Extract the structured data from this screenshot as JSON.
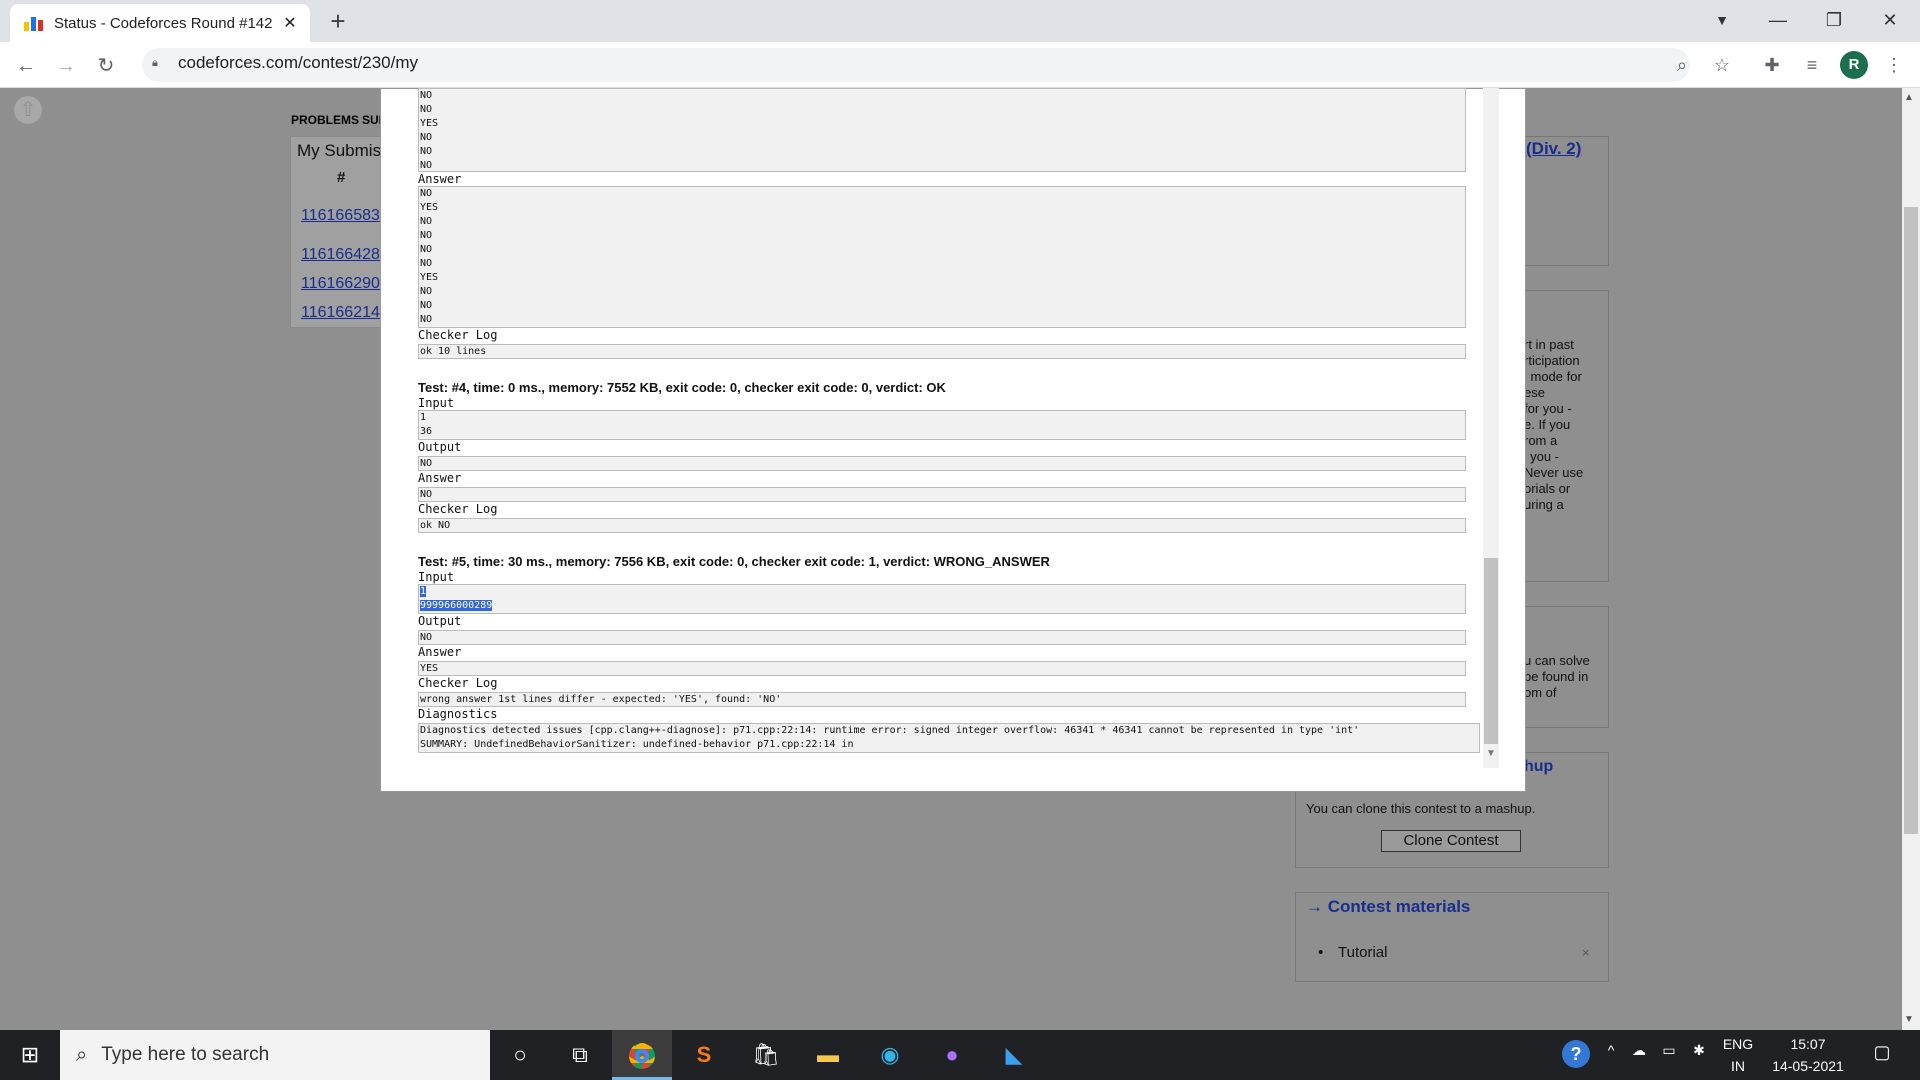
{
  "browser": {
    "tab_title": "Status - Codeforces Round #142",
    "tab_close": "✕",
    "new_tab": "+",
    "url": "codeforces.com/contest/230/my",
    "avatar_letter": "R",
    "controls": {
      "minimize": "—",
      "maximize": "❐",
      "close": "✕"
    }
  },
  "page": {
    "menu_problems": "PROBLEMS",
    "menu_submit": "SUB",
    "my_submissions_header": "My Submis",
    "table_header_hash": "#",
    "submissions": [
      "116166583",
      "116166428",
      "116166290",
      "116166214"
    ],
    "right_title": "(Div. 2)",
    "virtual_text": [
      "rt in past",
      "rticipation",
      "l mode for",
      "ese",
      "for you -",
      "e. If you",
      "rom a",
      "' you -",
      "Never use",
      "orials or",
      "uring a"
    ],
    "practice_text": [
      "u can solve",
      "be found in",
      "om of"
    ],
    "mashup_title": "hup",
    "mashup_text": "You can clone this contest to a mashup.",
    "clone_button": "Clone Contest",
    "materials_title": "→ Contest materials",
    "materials_item": "Tutorial",
    "materials_remove": "×"
  },
  "modal": {
    "test3_output_tail": [
      "NO",
      "NO",
      "YES",
      "NO",
      "NO",
      "NO"
    ],
    "answer_label": "Answer",
    "test3_answer": [
      "NO",
      "YES",
      "NO",
      "NO",
      "NO",
      "NO",
      "YES",
      "NO",
      "NO",
      "NO"
    ],
    "checker_log_label": "Checker Log",
    "test3_checker": "ok 10 lines",
    "test4_title": "Test: #4, time: 0 ms., memory: 7552 KB, exit code: 0, checker exit code: 0, verdict: OK",
    "input_label": "Input",
    "test4_input": [
      "1",
      "36"
    ],
    "output_label": "Output",
    "test4_output": "NO",
    "test4_answer": "NO",
    "test4_checker": "ok NO",
    "test5_title": "Test: #5, time: 30 ms., memory: 7556 KB, exit code: 0, checker exit code: 1, verdict: WRONG_ANSWER",
    "test5_input": [
      "1",
      "999966000289"
    ],
    "test5_output": "NO",
    "test5_answer": "YES",
    "test5_checker": "wrong answer 1st lines differ - expected: 'YES', found: 'NO'",
    "diagnostics_label": "Diagnostics",
    "test5_diagnostics": [
      "Diagnostics detected issues [cpp.clang++-diagnose]: p71.cpp:22:14: runtime error: signed integer overflow: 46341 * 46341 cannot be represented in type 'int'",
      "SUMMARY: UndefinedBehaviorSanitizer: undefined-behavior p71.cpp:22:14 in"
    ]
  },
  "taskbar": {
    "search_placeholder": "Type here to search",
    "lang": "ENG",
    "region": "IN",
    "time": "15:07",
    "date": "14-05-2021"
  },
  "colors": {
    "accent": "#1a2d8c",
    "selection": "#3367d6",
    "taskbar": "#202124"
  }
}
